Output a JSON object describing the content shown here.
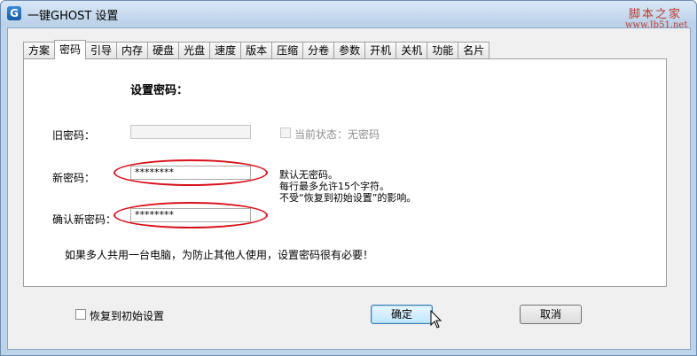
{
  "window": {
    "title": "一键GHOST 设置",
    "app_icon": "G"
  },
  "watermark": {
    "text": "脚本之家",
    "url": "www.Jb51.net"
  },
  "tabs": [
    {
      "label": "方案"
    },
    {
      "label": "密码",
      "active": true
    },
    {
      "label": "引导"
    },
    {
      "label": "内存"
    },
    {
      "label": "硬盘"
    },
    {
      "label": "光盘"
    },
    {
      "label": "速度"
    },
    {
      "label": "版本"
    },
    {
      "label": "压缩"
    },
    {
      "label": "分卷"
    },
    {
      "label": "参数"
    },
    {
      "label": "开机"
    },
    {
      "label": "关机"
    },
    {
      "label": "功能"
    },
    {
      "label": "名片"
    }
  ],
  "password_panel": {
    "heading": "设置密码：",
    "old_password": {
      "label": "旧密码：",
      "value": ""
    },
    "current_status": {
      "label": "当前状态：无密码",
      "checked": false
    },
    "new_password": {
      "label": "新密码：",
      "value": "********"
    },
    "confirm_password": {
      "label": "确认新密码：",
      "value": "********"
    },
    "hint_lines": [
      "默认无密码。",
      "每行最多允许15个字符。",
      "不受“恢复到初始设置”的影响。"
    ],
    "note": "如果多人共用一台电脑，为防止其他人使用，设置密码很有必要！"
  },
  "footer": {
    "restore_defaults": {
      "label": "恢复到初始设置",
      "checked": false
    },
    "ok_label": "确定",
    "cancel_label": "取消"
  },
  "colors": {
    "highlight_ellipse": "#d8101a",
    "title_bar": "#c9dcef"
  }
}
